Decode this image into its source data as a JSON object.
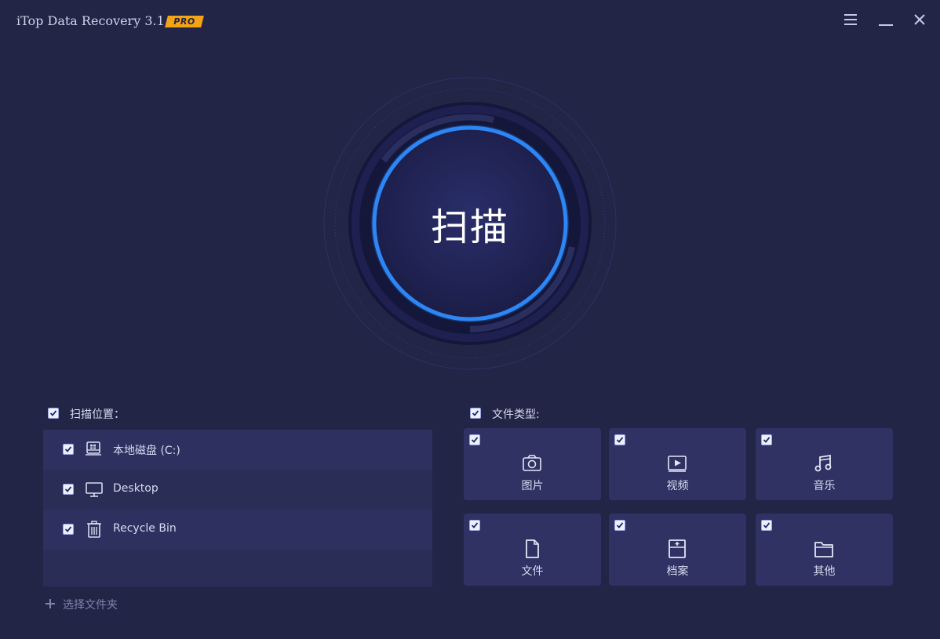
{
  "app": {
    "title": "iTop Data Recovery 3.1",
    "badge": "PRO",
    "accent_color": "#2a7cf2",
    "badge_color": "#f5a316",
    "background_color": "#232546"
  },
  "window_controls": {
    "menu_icon": "hamburger-menu-icon",
    "minimize_icon": "minimize-icon",
    "close_icon": "close-icon"
  },
  "scan": {
    "label": "扫描"
  },
  "scan_location": {
    "title": "扫描位置：",
    "checked": true,
    "items": [
      {
        "label": "本地磁盘 (C:)",
        "icon": "local-disk-icon",
        "checked": true
      },
      {
        "label": "Desktop",
        "icon": "desktop-monitor-icon",
        "checked": true
      },
      {
        "label": "Recycle Bin",
        "icon": "recycle-bin-icon",
        "checked": true
      }
    ],
    "add_folder": "选择文件夹"
  },
  "file_types": {
    "title": "文件类型:",
    "checked": true,
    "items": [
      {
        "label": "图片",
        "icon": "camera-icon",
        "checked": true
      },
      {
        "label": "视频",
        "icon": "video-icon",
        "checked": true
      },
      {
        "label": "音乐",
        "icon": "music-note-icon",
        "checked": true
      },
      {
        "label": "文件",
        "icon": "document-icon",
        "checked": true
      },
      {
        "label": "档案",
        "icon": "archive-icon",
        "checked": true
      },
      {
        "label": "其他",
        "icon": "folder-icon",
        "checked": true
      }
    ]
  }
}
